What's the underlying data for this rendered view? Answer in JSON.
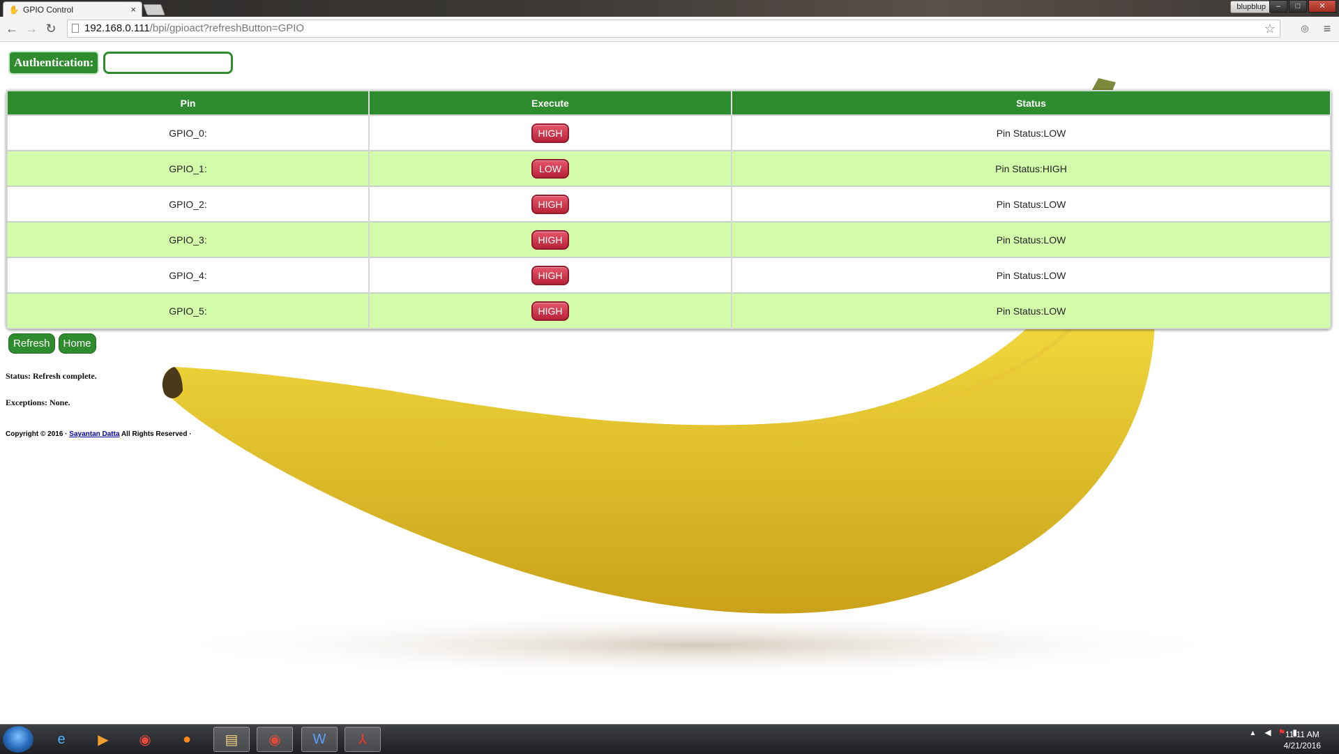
{
  "browser": {
    "tab_title": "GPIO Control",
    "tab_close": "×",
    "user_badge": "blupblup",
    "url_host": "192.168.0.111",
    "url_path": "/bpi/gpioact?refreshButton=GPIO",
    "nav_icons": [
      "back-arrow-icon",
      "forward-arrow-icon",
      "reload-icon",
      "star-icon",
      "menu-icon"
    ]
  },
  "page": {
    "auth_label": "Authentication:",
    "auth_value": "",
    "table": {
      "headers": [
        "Pin",
        "Execute",
        "Status"
      ],
      "rows": [
        {
          "pin": "GPIO_0:",
          "execute": "HIGH",
          "status": "Pin Status:LOW"
        },
        {
          "pin": "GPIO_1:",
          "execute": "LOW",
          "status": "Pin Status:HIGH"
        },
        {
          "pin": "GPIO_2:",
          "execute": "HIGH",
          "status": "Pin Status:LOW"
        },
        {
          "pin": "GPIO_3:",
          "execute": "HIGH",
          "status": "Pin Status:LOW"
        },
        {
          "pin": "GPIO_4:",
          "execute": "HIGH",
          "status": "Pin Status:LOW"
        },
        {
          "pin": "GPIO_5:",
          "execute": "HIGH",
          "status": "Pin Status:LOW"
        }
      ]
    },
    "refresh_label": "Refresh",
    "home_label": "Home",
    "status_text": "Status: Refresh complete.",
    "exceptions_text": "Exceptions: None.",
    "copyright_prefix": "Copyright © 2016 ·",
    "copyright_link": "Sayantan Datta",
    "copyright_suffix": "All Rights Reserved ·"
  },
  "taskbar": {
    "apps": [
      "internet-explorer-icon",
      "media-player-icon",
      "chrome-icon",
      "firefox-icon",
      "file-explorer-icon",
      "chrome-icon",
      "word-icon",
      "acrobat-icon"
    ],
    "time": "11:11 AM",
    "date": "4/21/2016"
  },
  "colors": {
    "header_green": "#2e8b2e",
    "row_alt": "#d3fcaa",
    "execute_button": "#c8304a"
  }
}
